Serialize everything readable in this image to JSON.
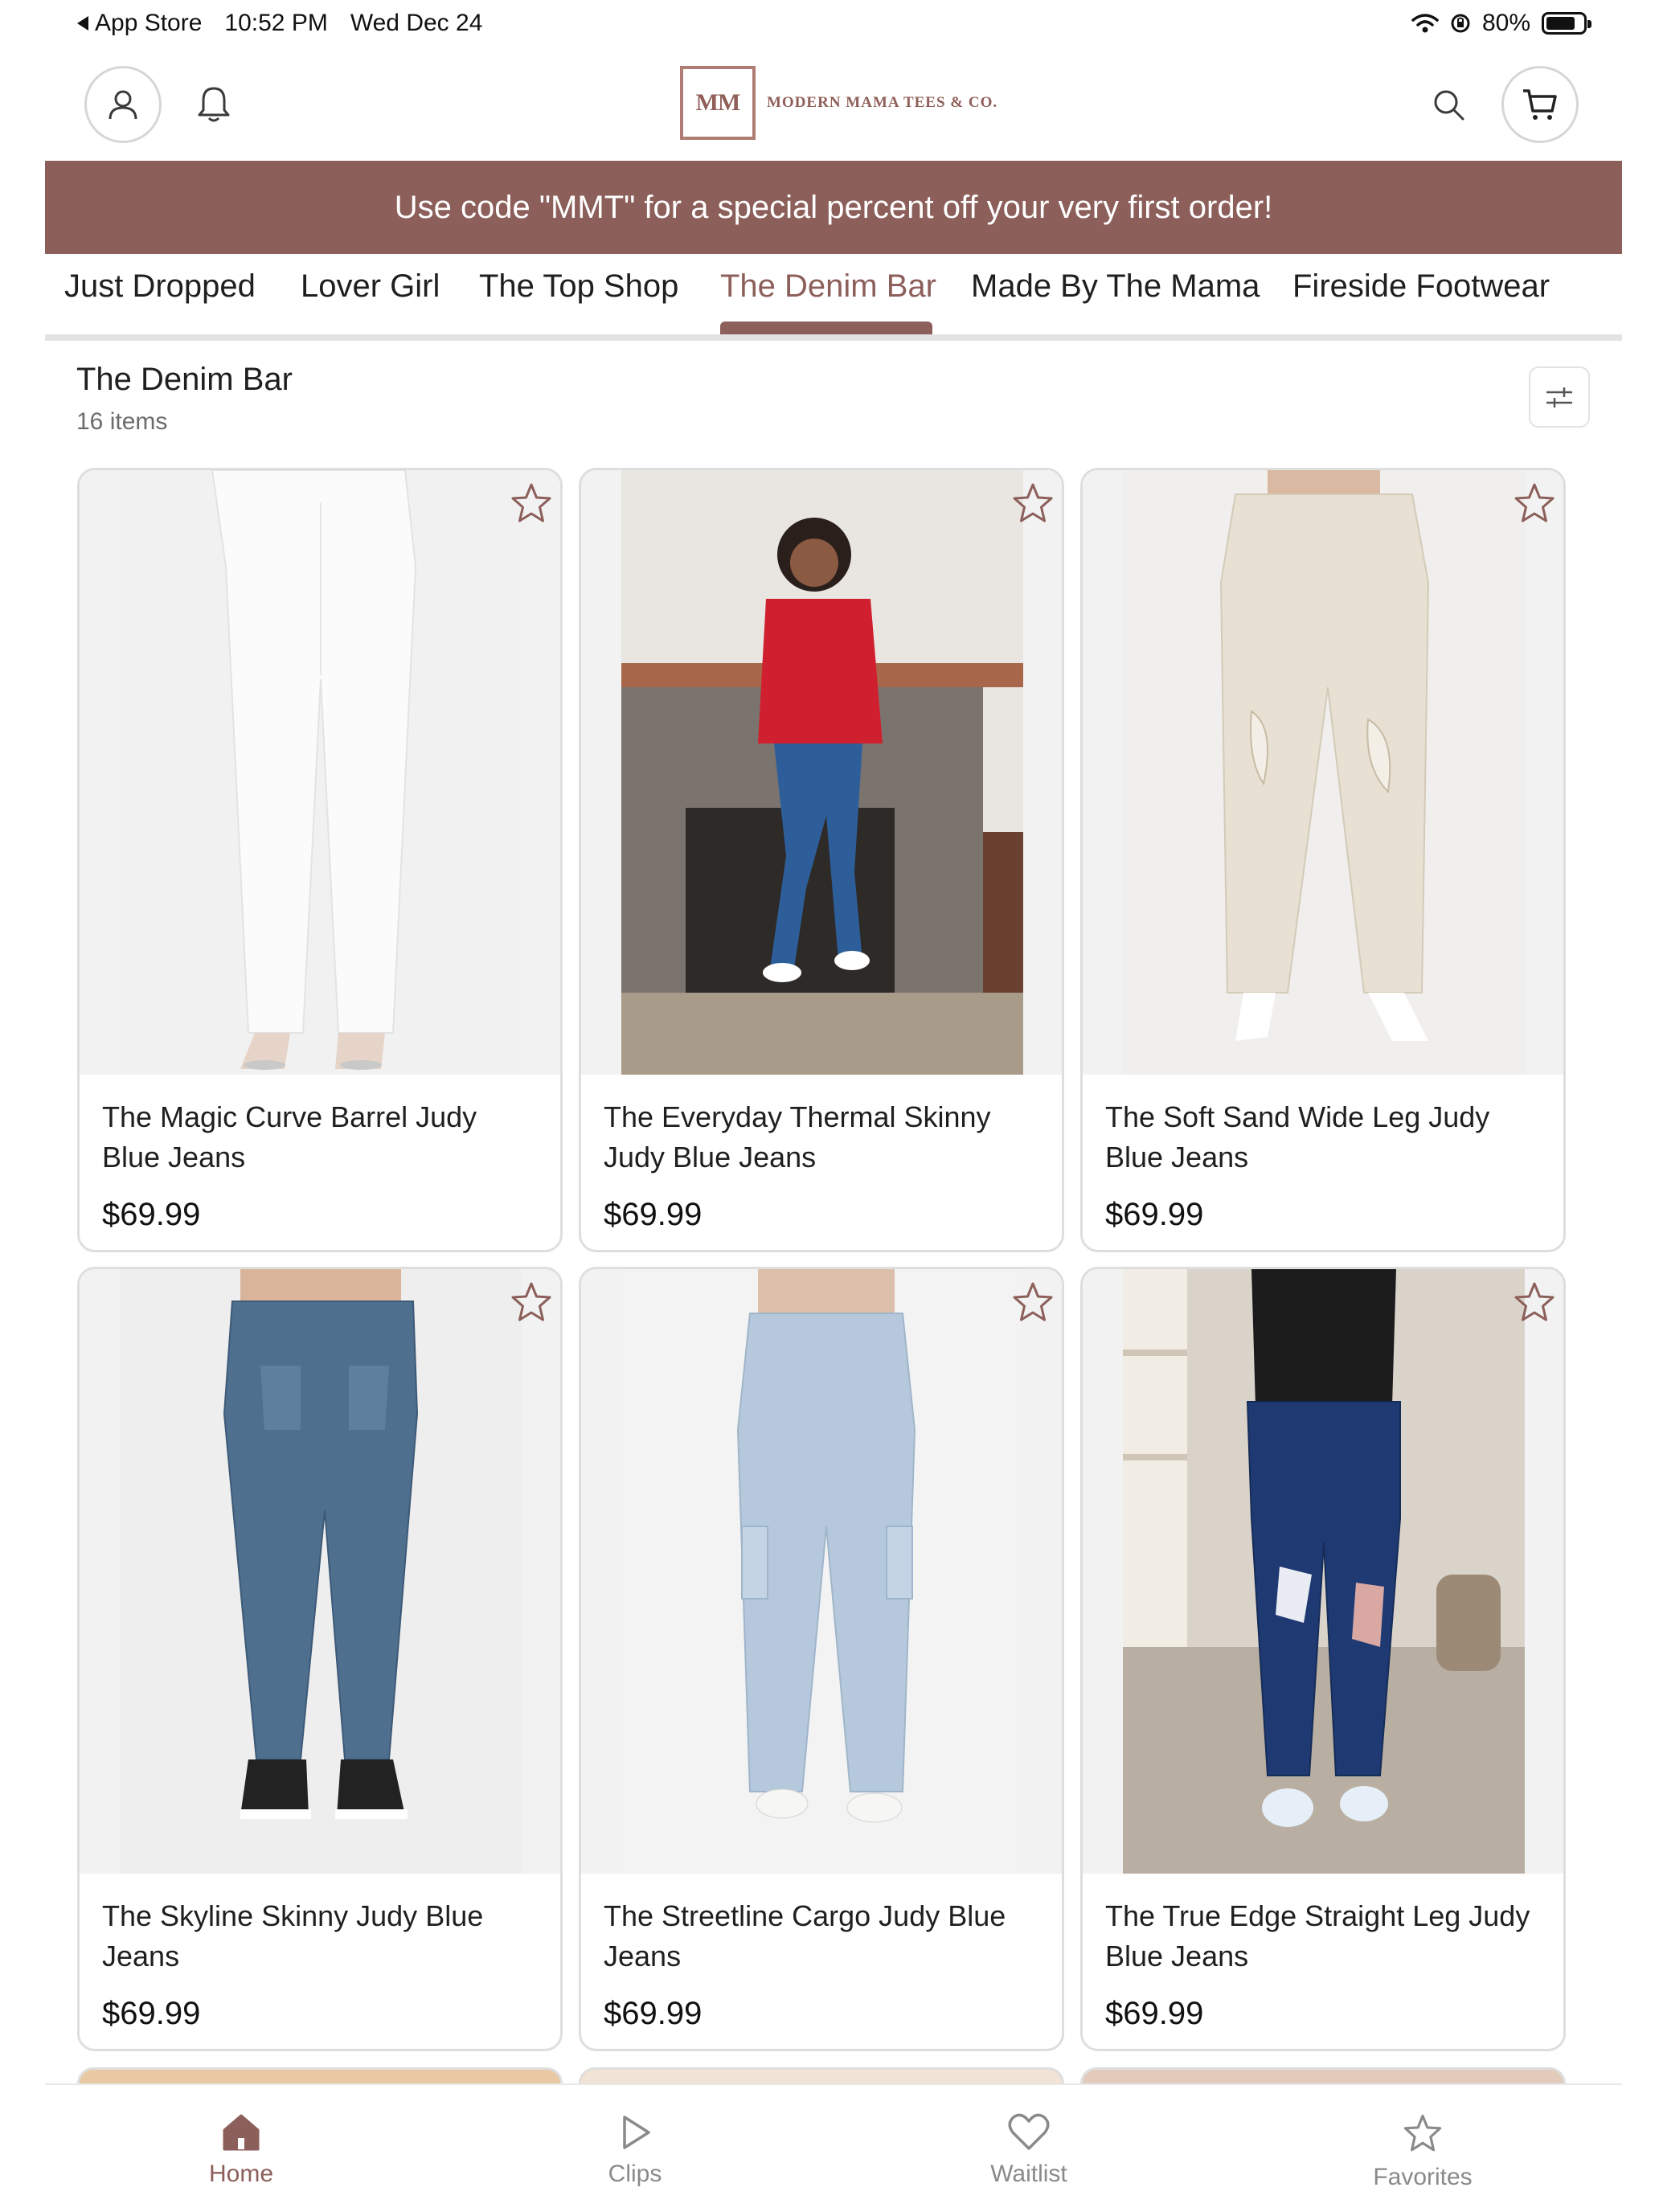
{
  "status_bar": {
    "back_app": "App Store",
    "time": "10:52 PM",
    "date": "Wed Dec 24",
    "battery": "80%",
    "battery_level": 0.8
  },
  "header": {
    "logo_mark": "MM",
    "logo_name": "MODERN MAMA TEES & CO.",
    "icons": [
      "account-icon",
      "bell-icon",
      "search-icon",
      "cart-icon"
    ]
  },
  "promo": {
    "text": "Use code \"MMT\" for a special percent off your very first order!"
  },
  "tabs": [
    {
      "label": "Just Dropped",
      "active": false
    },
    {
      "label": "Lover Girl",
      "active": false
    },
    {
      "label": "The Top Shop",
      "active": false
    },
    {
      "label": "The Denim Bar",
      "active": true
    },
    {
      "label": "Made By The Mama",
      "active": false
    },
    {
      "label": "Fireside Footwear",
      "active": false
    }
  ],
  "collection": {
    "title": "The Denim Bar",
    "count": "16 items"
  },
  "products": [
    {
      "name": "The Magic Curve Barrel Judy Blue Jeans",
      "price": "$69.99",
      "image": "white barrel jeans"
    },
    {
      "name": "The Everyday Thermal Skinny Judy Blue Jeans",
      "price": "$69.99",
      "image": "model in red sweater by fireplace"
    },
    {
      "name": "The Soft Sand Wide Leg Judy Blue Jeans",
      "price": "$69.99",
      "image": "sand wide leg distressed jeans"
    },
    {
      "name": "The Skyline Skinny Judy Blue Jeans",
      "price": "$69.99",
      "image": "medium wash skinny jeans"
    },
    {
      "name": "The Streetline Cargo Judy Blue Jeans",
      "price": "$69.99",
      "image": "light wash cargo jeans"
    },
    {
      "name": "The True Edge Straight Leg Judy Blue Jeans",
      "price": "$69.99",
      "image": "dark wash distressed straight jeans"
    }
  ],
  "bottom_nav": [
    {
      "label": "Home",
      "icon": "home-icon",
      "active": true
    },
    {
      "label": "Clips",
      "icon": "play-icon",
      "active": false
    },
    {
      "label": "Waitlist",
      "icon": "heart-icon",
      "active": false
    },
    {
      "label": "Favorites",
      "icon": "star-icon",
      "active": false
    }
  ],
  "colors": {
    "brand": "#8c5f5a",
    "text": "#1f1f1f",
    "muted": "#8a8a8a"
  }
}
